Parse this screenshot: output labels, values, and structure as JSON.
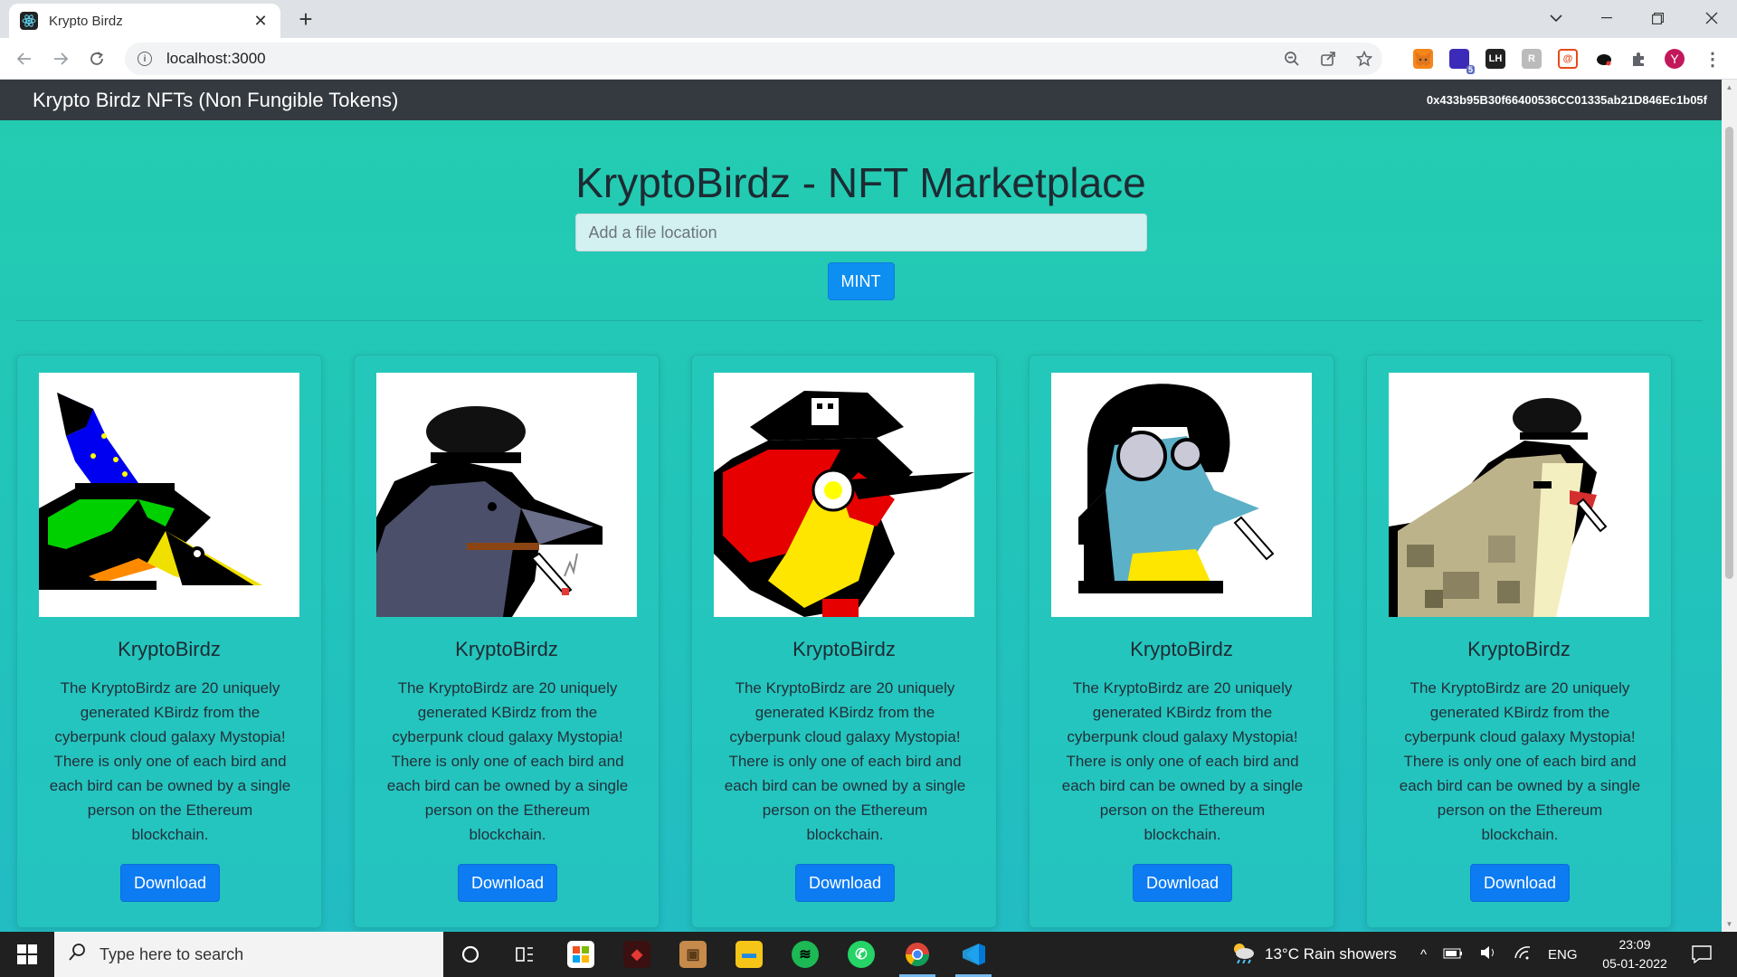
{
  "browser": {
    "tab_title": "Krypto Birdz",
    "url": "localhost:3000",
    "new_tab": "+",
    "tab_close": "✕",
    "extension_badge": "5",
    "profile_initial": "Y"
  },
  "navbar": {
    "brand": "Krypto Birdz NFTs (Non Fungible Tokens)",
    "account": "0x433b95B30f66400536CC01335ab21D846Ec1b05f"
  },
  "hero": {
    "title": "KryptoBirdz - NFT Marketplace",
    "input_placeholder": "Add a file location",
    "mint_label": "MINT"
  },
  "cards": [
    {
      "title": "KryptoBirdz",
      "text": "The KryptoBirdz are 20 uniquely generated KBirdz from the cyberpunk cloud galaxy Mystopia! There is only one of each bird and each bird can be owned by a single person on the Ethereum blockchain.",
      "button": "Download",
      "image": "wizard-bird"
    },
    {
      "title": "KryptoBirdz",
      "text": "The KryptoBirdz are 20 uniquely generated KBirdz from the cyberpunk cloud galaxy Mystopia! There is only one of each bird and each bird can be owned by a single person on the Ethereum blockchain.",
      "button": "Download",
      "image": "bowler-hat-crow"
    },
    {
      "title": "KryptoBirdz",
      "text": "The KryptoBirdz are 20 uniquely generated KBirdz from the cyberpunk cloud galaxy Mystopia! There is only one of each bird and each bird can be owned by a single person on the Ethereum blockchain.",
      "button": "Download",
      "image": "pirate-bird"
    },
    {
      "title": "KryptoBirdz",
      "text": "The KryptoBirdz are 20 uniquely generated KBirdz from the cyberpunk cloud galaxy Mystopia! There is only one of each bird and each bird can be owned by a single person on the Ethereum blockchain.",
      "button": "Download",
      "image": "sunglasses-bird"
    },
    {
      "title": "KryptoBirdz",
      "text": "The KryptoBirdz are 20 uniquely generated KBirdz from the cyberpunk cloud galaxy Mystopia! There is only one of each bird and each bird can be owned by a single person on the Ethereum blockchain.",
      "button": "Download",
      "image": "camo-bird"
    }
  ],
  "taskbar": {
    "search_placeholder": "Type here to search",
    "weather": "13°C  Rain showers",
    "language": "ENG",
    "time": "23:09",
    "date": "05-01-2022"
  },
  "colors": {
    "navbar": "#343a40",
    "page_gradient_top": "#23cdb0",
    "page_gradient_bottom": "#22bcc3",
    "primary_button": "#0d7bf2"
  }
}
